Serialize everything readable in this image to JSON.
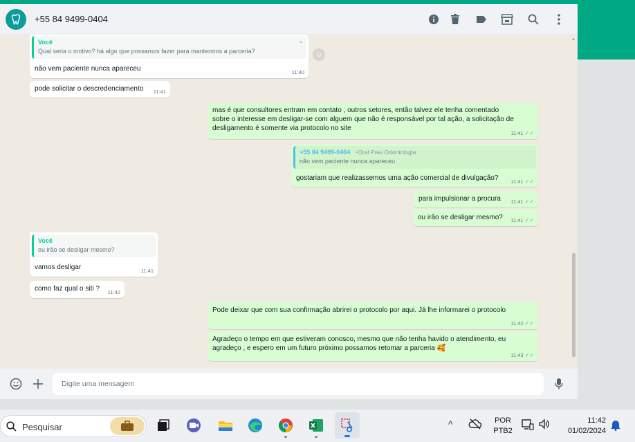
{
  "header": {
    "contact_name": "+55 84 9499-0404"
  },
  "messages": {
    "m1_quote_author": "Você",
    "m1_quote_text": "Qual seria o motivo? há algo que possamos fazer para mantermos a parceria?",
    "m1_text": "não vem paciente nunca apareceu",
    "m1_time": "11:40",
    "m2_text": "pode solicitar o descredenciamento",
    "m2_time": "11:41",
    "m3_line1": "mas é que consultores entram em contato , outros setores, então talvez ele tenha comentado",
    "m3_line2": "sobre o interesse em desligar-se com alguem que não é responsável por tal ação, a solicitação de",
    "m3_line3": "desligamento é somente via protocolo no site",
    "m3_time": "11:41",
    "m4_quote_author": "+55 84 9499-0404",
    "m4_quote_sub": "~Oral Prev Odontologia",
    "m4_quote_text": "não vem paciente nunca apareceu",
    "m5_text": "gostariam que realizassemos uma ação comercial de divulgação?",
    "m5_time": "11:41",
    "m6_text": "para impulsionar a procura",
    "m6_time": "11:41",
    "m7_text": "ou irão se desligar mesmo?",
    "m7_time": "11:41",
    "m8_quote_author": "Você",
    "m8_quote_text": "ou irão se desligar mesmo?",
    "m8_text": "vamos desligar",
    "m8_time": "11:41",
    "m9_text": "como faz qual o siti ?",
    "m9_time": "11:42",
    "m10_text": "Pode deixar que com sua confirmação abrirei o protocolo por aqui. Já lhe informarei o protocolo",
    "m10_time": "11:42",
    "m11_line1": "Agradeço o tempo em que estiveram conosco, mesmo que não tenha havido o atendimento, eu",
    "m11_line2": "agradeço , e espero em um futuro próximo possamos retomar a parceria 🥰",
    "m11_time": "11:43"
  },
  "footer": {
    "placeholder": "Digite uma mensagem"
  },
  "taskbar": {
    "search_label": "Pesquisar",
    "lang_top": "POR",
    "lang_bottom": "PTB2",
    "time": "11:42",
    "date": "01/02/2024"
  },
  "colors": {
    "accent": "#00a884",
    "outgoing_bubble": "#d9fdd3",
    "incoming_bubble": "#ffffff",
    "chat_bg": "#efeae2"
  },
  "icons": [
    "tooth-avatar-icon",
    "info-icon",
    "trash-icon",
    "label-icon",
    "store-icon",
    "search-icon",
    "menu-icon",
    "emoji-icon",
    "plus-icon",
    "mic-icon",
    "scroll-up-icon",
    "reaction-icon",
    "chevron-down-icon",
    "read-ticks-icon"
  ]
}
